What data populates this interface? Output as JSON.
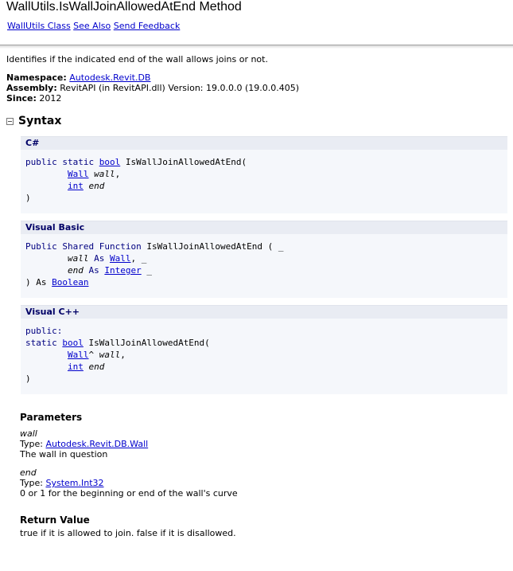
{
  "header": {
    "title": "WallUtils.IsWallJoinAllowedAtEnd Method",
    "links": [
      "WallUtils Class",
      "See Also",
      "Send Feedback"
    ]
  },
  "summary": "Identifies if the indicated end of the wall allows joins or not.",
  "meta": {
    "namespace_label": "Namespace:",
    "namespace_value": "Autodesk.Revit.DB",
    "assembly_label": "Assembly:",
    "assembly_value": "RevitAPI (in RevitAPI.dll) Version: 19.0.0.0 (19.0.0.405)",
    "since_label": "Since:",
    "since_value": "2012"
  },
  "syntax": {
    "title": "Syntax",
    "csharp": {
      "lang": "C#",
      "l1_kw": "public static ",
      "l1_type": "bool",
      "l1_rest": " IsWallJoinAllowedAtEnd(",
      "l2_type": "Wall",
      "l2_param": "wall",
      "l2_end": ",",
      "l3_type": "int",
      "l3_param": "end",
      "l4": ")"
    },
    "vb": {
      "lang": "Visual Basic",
      "l1_kw": "Public Shared Function ",
      "l1_rest": "IsWallJoinAllowedAtEnd ( _",
      "l2_param": "wall",
      "l2_as": " As ",
      "l2_type": "Wall",
      "l2_end": ", _",
      "l3_param": "end",
      "l3_as": " As ",
      "l3_type": "Integer",
      "l3_end": " _",
      "l4_start": ") As ",
      "l4_type": "Boolean"
    },
    "cpp": {
      "lang": "Visual C++",
      "l1": "public:",
      "l2_kw": "static ",
      "l2_type": "bool",
      "l2_rest": " IsWallJoinAllowedAtEnd(",
      "l3_type": "Wall",
      "l3_hat": "^ ",
      "l3_param": "wall",
      "l3_end": ",",
      "l4_type": "int",
      "l4_param": "end",
      "l5": ")"
    }
  },
  "parameters": {
    "title": "Parameters",
    "items": [
      {
        "name": "wall",
        "type_label": "Type: ",
        "type_value": "Autodesk.Revit.DB.Wall",
        "desc": "The wall in question"
      },
      {
        "name": "end",
        "type_label": "Type: ",
        "type_value": "System.Int32",
        "desc": "0 or 1 for the beginning or end of the wall's curve"
      }
    ]
  },
  "return_value": {
    "title": "Return Value",
    "text": "true if it is allowed to join. false if it is disallowed."
  }
}
